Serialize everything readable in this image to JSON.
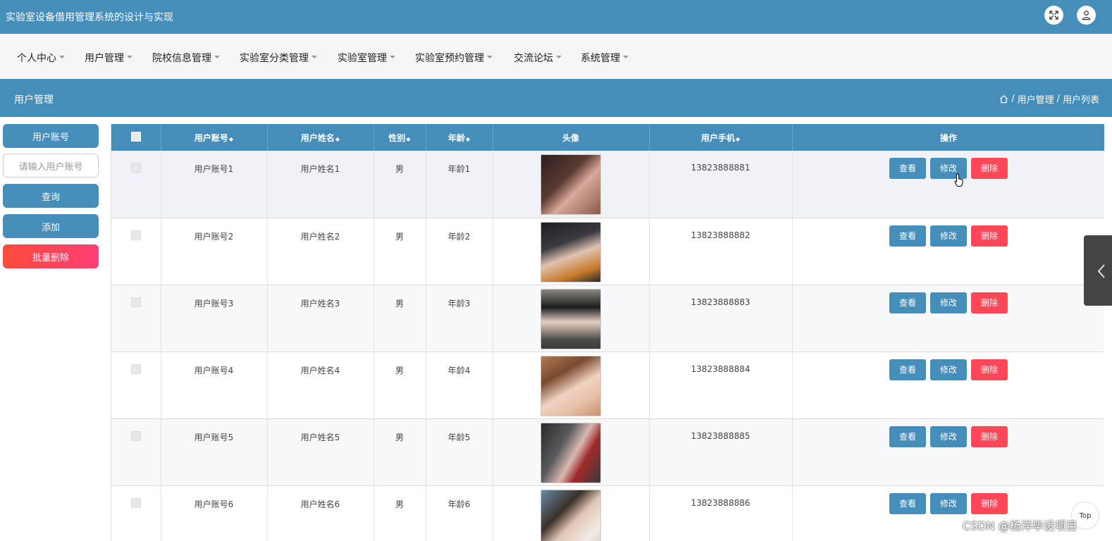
{
  "app": {
    "title": "实验室设备借用管理系统的设计与实现",
    "icons": [
      "fullscreen-icon",
      "user-icon"
    ]
  },
  "nav": {
    "items": [
      "个人中心",
      "用户管理",
      "院校信息管理",
      "实验室分类管理",
      "实验室管理",
      "实验室预约管理",
      "交流论坛",
      "系统管理"
    ]
  },
  "page": {
    "title": "用户管理",
    "breadcrumb": [
      "用户管理",
      "用户列表"
    ]
  },
  "sidebar": {
    "field_label": "用户账号",
    "search_placeholder": "请输入用户账号",
    "query_label": "查询",
    "add_label": "添加",
    "batch_delete_label": "批量删除"
  },
  "table": {
    "columns": [
      "用户账号",
      "用户姓名",
      "性别",
      "年龄",
      "头像",
      "用户手机",
      "操作"
    ],
    "rows": [
      {
        "account": "用户账号1",
        "name": "用户姓名1",
        "gender": "男",
        "age": "年龄1",
        "phone": "13823888881"
      },
      {
        "account": "用户账号2",
        "name": "用户姓名2",
        "gender": "男",
        "age": "年龄2",
        "phone": "13823888882"
      },
      {
        "account": "用户账号3",
        "name": "用户姓名3",
        "gender": "男",
        "age": "年龄3",
        "phone": "13823888883"
      },
      {
        "account": "用户账号4",
        "name": "用户姓名4",
        "gender": "男",
        "age": "年龄4",
        "phone": "13823888884"
      },
      {
        "account": "用户账号5",
        "name": "用户姓名5",
        "gender": "男",
        "age": "年龄5",
        "phone": "13823888885"
      },
      {
        "account": "用户账号6",
        "name": "用户姓名6",
        "gender": "男",
        "age": "年龄6",
        "phone": "13823888886"
      }
    ],
    "actions": {
      "view": "查看",
      "edit": "修改",
      "delete": "删除"
    }
  },
  "footer": {
    "top_label": "Top",
    "watermark": "CSDN @杨洋毕设项目"
  },
  "colors": {
    "primary": "#458dbb",
    "danger": "#ff4757",
    "nav_bg": "#f5f5f7"
  }
}
